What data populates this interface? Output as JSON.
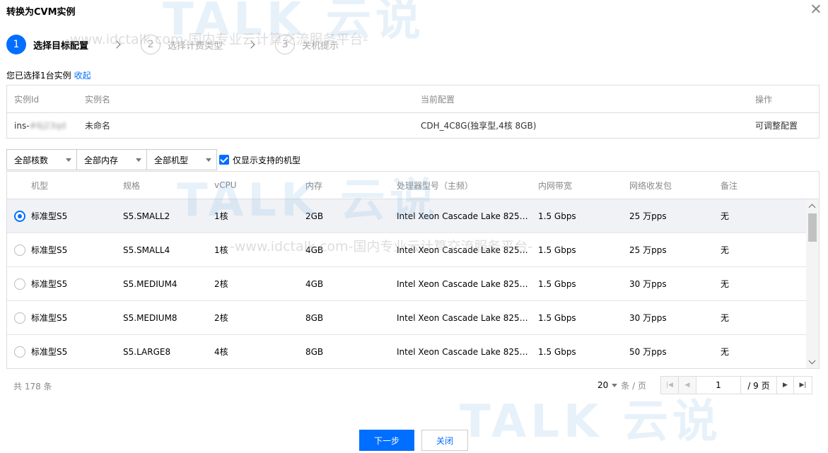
{
  "dialog": {
    "title": "转换为CVM实例",
    "close_label": "×"
  },
  "steps": [
    {
      "num": "1",
      "label": "选择目标配置",
      "active": true
    },
    {
      "num": "2",
      "label": "选择计费类型",
      "active": false
    },
    {
      "num": "3",
      "label": "关机提示",
      "active": false
    }
  ],
  "selected": {
    "text": "您已选择1台实例",
    "collapse_link": "收起"
  },
  "instance_table": {
    "headers": [
      "实例Id",
      "实例名",
      "当前配置",
      "操作"
    ],
    "row": {
      "id_prefix": "ins-",
      "id_masked": "#6j23qd",
      "name": "未命名",
      "config": "CDH_4C8G(独享型,4核 8GB)",
      "action": "可调整配置"
    }
  },
  "filters": {
    "cores": "全部核数",
    "memory": "全部内存",
    "model": "全部机型",
    "only_supported": "仅显示支持的机型"
  },
  "model_table": {
    "headers": [
      "机型",
      "规格",
      "vCPU",
      "内存",
      "处理器型号（主频）",
      "内网带宽",
      "网络收发包",
      "备注"
    ],
    "rows": [
      {
        "type": "标准型S5",
        "spec": "S5.SMALL2",
        "cpu": "1核",
        "mem": "2GB",
        "cpu_type": "Intel Xeon Cascade Lake 8255...",
        "bw": "1.5 Gbps",
        "pps": "25 万pps",
        "note": "无",
        "selected": true
      },
      {
        "type": "标准型S5",
        "spec": "S5.SMALL4",
        "cpu": "1核",
        "mem": "4GB",
        "cpu_type": "Intel Xeon Cascade Lake 8255...",
        "bw": "1.5 Gbps",
        "pps": "25 万pps",
        "note": "无",
        "selected": false
      },
      {
        "type": "标准型S5",
        "spec": "S5.MEDIUM4",
        "cpu": "2核",
        "mem": "4GB",
        "cpu_type": "Intel Xeon Cascade Lake 8255...",
        "bw": "1.5 Gbps",
        "pps": "30 万pps",
        "note": "无",
        "selected": false
      },
      {
        "type": "标准型S5",
        "spec": "S5.MEDIUM8",
        "cpu": "2核",
        "mem": "8GB",
        "cpu_type": "Intel Xeon Cascade Lake 8255...",
        "bw": "1.5 Gbps",
        "pps": "30 万pps",
        "note": "无",
        "selected": false
      },
      {
        "type": "标准型S5",
        "spec": "S5.LARGE8",
        "cpu": "4核",
        "mem": "8GB",
        "cpu_type": "Intel Xeon Cascade Lake 8255...",
        "bw": "1.5 Gbps",
        "pps": "50 万pps",
        "note": "无",
        "selected": false
      }
    ]
  },
  "pagination": {
    "total": "共 178 条",
    "page_size": "20",
    "page_size_unit": "条 / 页",
    "current_page": "1",
    "total_pages": "/ 9 页"
  },
  "buttons": {
    "next": "下一步",
    "close": "关闭"
  },
  "watermark": {
    "brand": "iDcTALK 云说",
    "url": "-www.idctalk.com-国内专业云计算交流服务平台-"
  },
  "colors": {
    "primary": "#006eff",
    "selected_row": "#f0f2f6"
  }
}
